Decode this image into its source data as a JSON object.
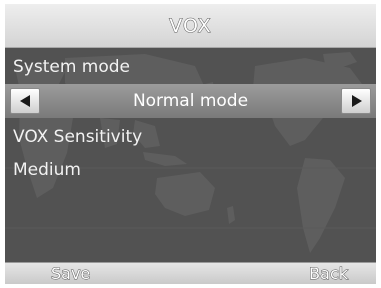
{
  "header": {
    "title": "VOX"
  },
  "menu": {
    "system_mode_label": "System mode",
    "system_mode_value": "Normal mode",
    "vox_sensitivity_label": "VOX Sensitivity",
    "vox_sensitivity_value": "Medium"
  },
  "softkeys": {
    "left": "Save",
    "right": "Back"
  },
  "colors": {
    "background": "#515151",
    "selector_bar": "#8a8a8a",
    "title_bar": "#e2e2e2",
    "text": "#f2f2f2"
  },
  "icons": {
    "prev": "left-arrow-icon",
    "next": "right-arrow-icon"
  }
}
